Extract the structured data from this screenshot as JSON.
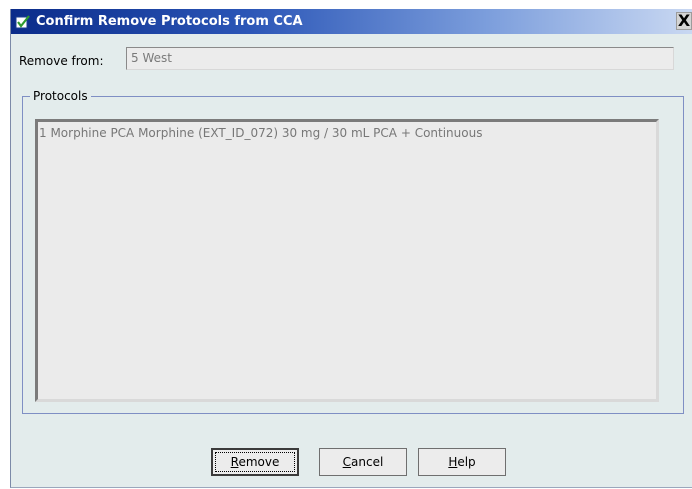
{
  "window": {
    "title": "Confirm Remove Protocols from CCA",
    "close_label": "X"
  },
  "form": {
    "remove_from_label": "Remove from:",
    "remove_from_value": "5 West"
  },
  "protocols": {
    "legend": "Protocols",
    "items": [
      "1 Morphine PCA Morphine (EXT_ID_072) 30 mg / 30 mL PCA + Continuous"
    ]
  },
  "buttons": {
    "remove": "Remove",
    "cancel": "Cancel",
    "help": "Help"
  },
  "colors": {
    "titlebar_start": "#0b2c8a",
    "titlebar_end": "#c9d8f2",
    "dialog_bg": "#e3ecec"
  },
  "icons": {
    "title": "dialog-check-icon"
  }
}
